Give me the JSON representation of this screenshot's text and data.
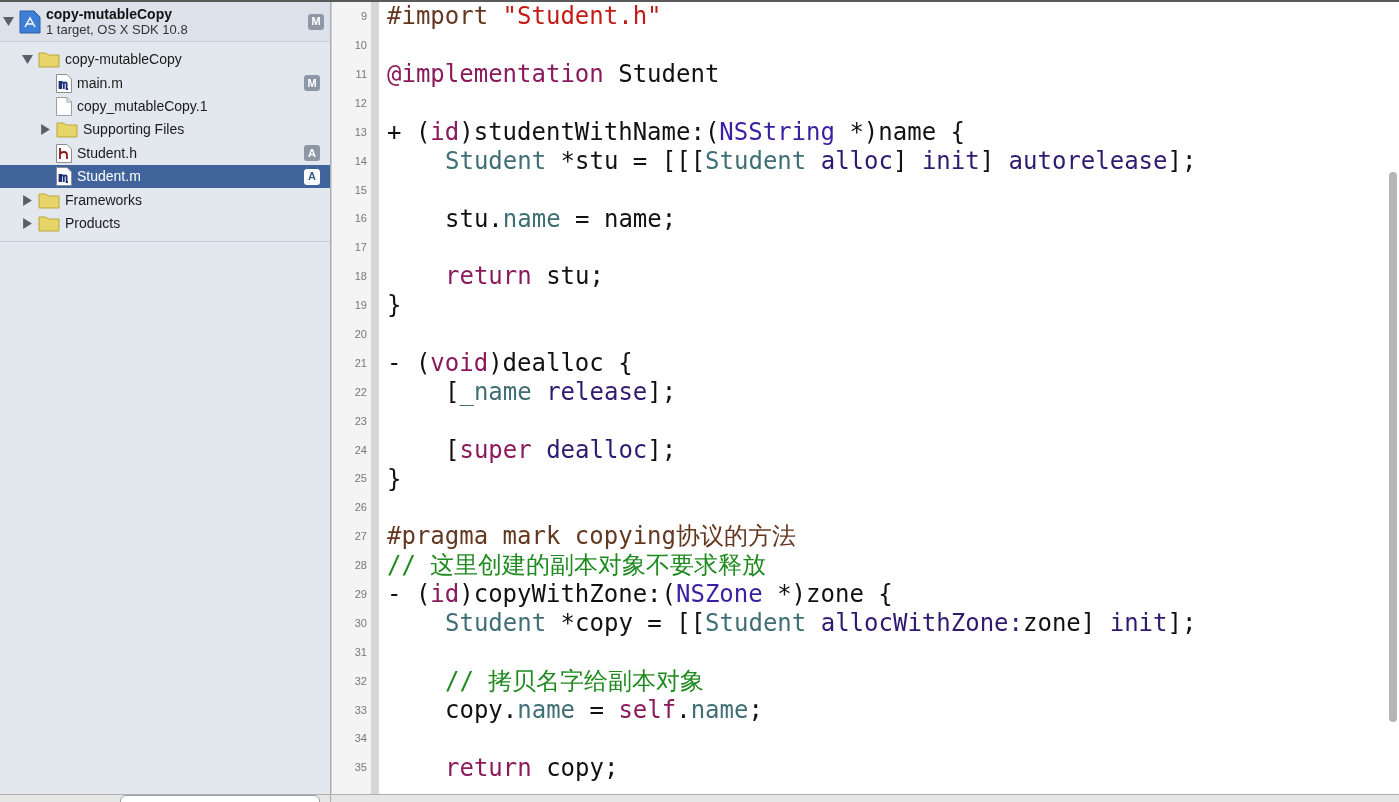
{
  "navigator": {
    "project": {
      "name": "copy-mutableCopy",
      "subtitle": "1 target, OS X SDK 10.8",
      "badge": "M",
      "expanded": true,
      "selected": false
    },
    "items": [
      {
        "name": "copy-mutableCopy",
        "kind": "folder",
        "expanded": true,
        "selected": false,
        "children": [
          {
            "name": "main.m",
            "kind": "m-file",
            "badge": "M",
            "selected": false
          },
          {
            "name": "copy_mutableCopy.1",
            "kind": "doc",
            "selected": false
          },
          {
            "name": "Supporting Files",
            "kind": "folder",
            "expanded": false,
            "selected": false
          },
          {
            "name": "Student.h",
            "kind": "h-file",
            "badge": "A",
            "selected": false
          },
          {
            "name": "Student.m",
            "kind": "m-file",
            "badge": "A",
            "selected": true
          }
        ]
      },
      {
        "name": "Frameworks",
        "kind": "folder",
        "expanded": false,
        "selected": false
      },
      {
        "name": "Products",
        "kind": "folder",
        "expanded": false,
        "selected": false
      }
    ]
  },
  "editor": {
    "lines": [
      {
        "number": "9",
        "tokens": [
          {
            "kind": "preproc",
            "text": "#import "
          },
          {
            "kind": "string",
            "text": "\"Student.h\""
          }
        ]
      },
      {
        "number": "10"
      },
      {
        "number": "11",
        "tokens": [
          {
            "kind": "keyword",
            "text": "@implementation"
          },
          {
            "kind": "plain",
            "text": " Student"
          }
        ]
      },
      {
        "number": "12"
      },
      {
        "number": "13",
        "tokens": [
          {
            "kind": "plain",
            "text": "+ ("
          },
          {
            "kind": "keyword",
            "text": "id"
          },
          {
            "kind": "plain",
            "text": ")studentWithName:("
          },
          {
            "kind": "libtype",
            "text": "NSString"
          },
          {
            "kind": "plain",
            "text": " *)name {"
          }
        ],
        "children": [
          {
            "number": "14",
            "tokens": [
              {
                "kind": "type",
                "text": "Student"
              },
              {
                "kind": "plain",
                "text": " *stu = [[["
              },
              {
                "kind": "type",
                "text": "Student"
              },
              {
                "kind": "method",
                "text": " alloc"
              },
              {
                "kind": "plain",
                "text": "] "
              },
              {
                "kind": "method",
                "text": "init"
              },
              {
                "kind": "plain",
                "text": "] "
              },
              {
                "kind": "method",
                "text": "autorelease"
              },
              {
                "kind": "plain",
                "text": "];"
              }
            ]
          },
          {
            "number": "15"
          },
          {
            "number": "16",
            "tokens": [
              {
                "kind": "plain",
                "text": "stu."
              },
              {
                "kind": "property",
                "text": "name"
              },
              {
                "kind": "plain",
                "text": " = name;"
              }
            ]
          },
          {
            "number": "17"
          },
          {
            "number": "18",
            "tokens": [
              {
                "kind": "keyword",
                "text": "return"
              },
              {
                "kind": "plain",
                "text": " stu;"
              }
            ]
          }
        ]
      },
      {
        "number": "19",
        "tokens": [
          {
            "kind": "plain",
            "text": "}"
          }
        ]
      },
      {
        "number": "20"
      },
      {
        "number": "21",
        "tokens": [
          {
            "kind": "plain",
            "text": "- ("
          },
          {
            "kind": "keyword",
            "text": "void"
          },
          {
            "kind": "plain",
            "text": ")dealloc {"
          }
        ],
        "children": [
          {
            "number": "22",
            "tokens": [
              {
                "kind": "plain",
                "text": "["
              },
              {
                "kind": "property",
                "text": "_name"
              },
              {
                "kind": "method",
                "text": " release"
              },
              {
                "kind": "plain",
                "text": "];"
              }
            ]
          },
          {
            "number": "23"
          },
          {
            "number": "24",
            "tokens": [
              {
                "kind": "plain",
                "text": "["
              },
              {
                "kind": "keyword",
                "text": "super"
              },
              {
                "kind": "method",
                "text": " dealloc"
              },
              {
                "kind": "plain",
                "text": "];"
              }
            ]
          }
        ]
      },
      {
        "number": "25",
        "tokens": [
          {
            "kind": "plain",
            "text": "}"
          }
        ]
      },
      {
        "number": "26"
      },
      {
        "number": "27",
        "tokens": [
          {
            "kind": "preproc",
            "text": "#pragma mark copying协议的方法"
          }
        ]
      },
      {
        "number": "28",
        "tokens": [
          {
            "kind": "comment",
            "text": "// 这里创建的副本对象不要求释放"
          }
        ]
      },
      {
        "number": "29",
        "tokens": [
          {
            "kind": "plain",
            "text": "- ("
          },
          {
            "kind": "keyword",
            "text": "id"
          },
          {
            "kind": "plain",
            "text": ")copyWithZone:("
          },
          {
            "kind": "libtype",
            "text": "NSZone"
          },
          {
            "kind": "plain",
            "text": " *)zone {"
          }
        ],
        "children": [
          {
            "number": "30",
            "tokens": [
              {
                "kind": "type",
                "text": "Student"
              },
              {
                "kind": "plain",
                "text": " *copy = [["
              },
              {
                "kind": "type",
                "text": "Student"
              },
              {
                "kind": "method",
                "text": " allocWithZone:"
              },
              {
                "kind": "plain",
                "text": "zone] "
              },
              {
                "kind": "method",
                "text": "init"
              },
              {
                "kind": "plain",
                "text": "];"
              }
            ]
          },
          {
            "number": "31"
          },
          {
            "number": "32",
            "tokens": [
              {
                "kind": "comment",
                "text": "// 拷贝名字给副本对象"
              }
            ]
          },
          {
            "number": "33",
            "tokens": [
              {
                "kind": "plain",
                "text": "copy."
              },
              {
                "kind": "property",
                "text": "name"
              },
              {
                "kind": "plain",
                "text": " = "
              },
              {
                "kind": "keyword",
                "text": "self"
              },
              {
                "kind": "plain",
                "text": "."
              },
              {
                "kind": "property",
                "text": "name"
              },
              {
                "kind": "plain",
                "text": ";"
              }
            ]
          },
          {
            "number": "34"
          },
          {
            "number": "35",
            "tokens": [
              {
                "kind": "keyword",
                "text": "return"
              },
              {
                "kind": "plain",
                "text": " copy;"
              }
            ]
          }
        ]
      }
    ]
  }
}
